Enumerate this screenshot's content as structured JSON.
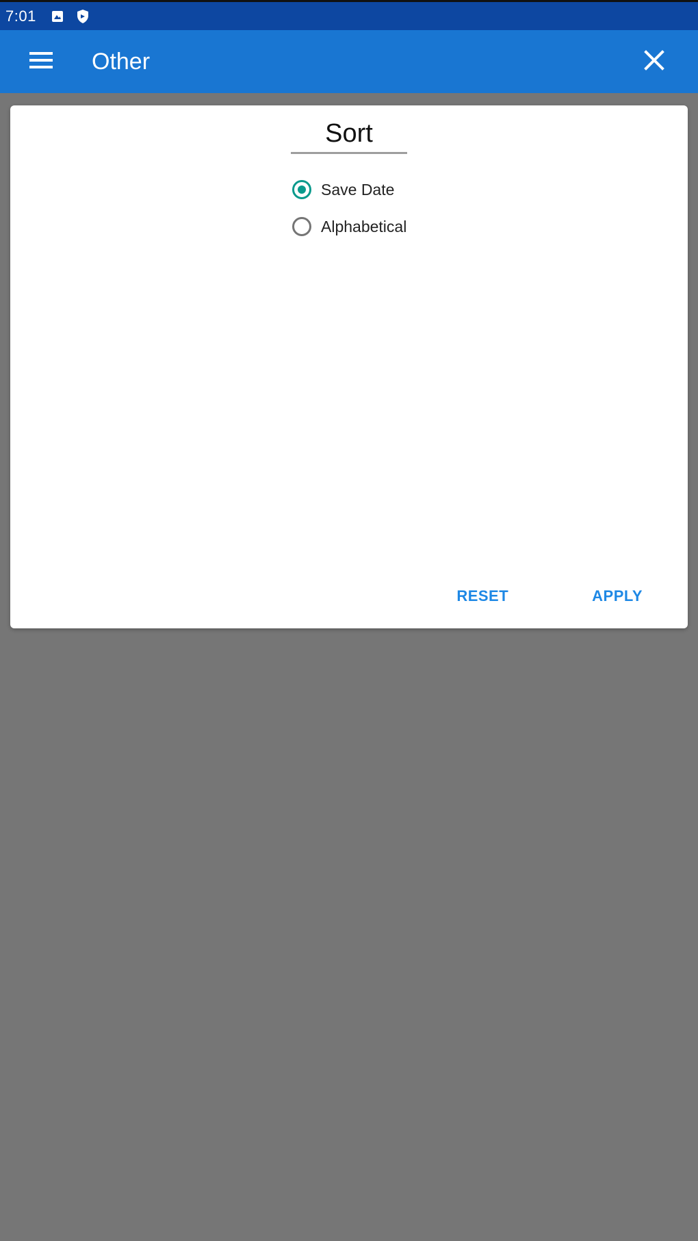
{
  "status_bar": {
    "time": "7:01",
    "icons": [
      "image-notification-icon",
      "shield-notification-icon"
    ]
  },
  "app_bar": {
    "title": "Other",
    "menu_icon": "hamburger-menu-icon",
    "close_icon": "close-icon",
    "background_color": "#1976d2"
  },
  "dialog": {
    "title": "Sort",
    "options": [
      {
        "label": "Save Date",
        "checked": true
      },
      {
        "label": "Alphabetical",
        "checked": false
      }
    ],
    "actions": {
      "reset_label": "RESET",
      "apply_label": "APPLY"
    },
    "accent_color": "#0a9a8c"
  }
}
